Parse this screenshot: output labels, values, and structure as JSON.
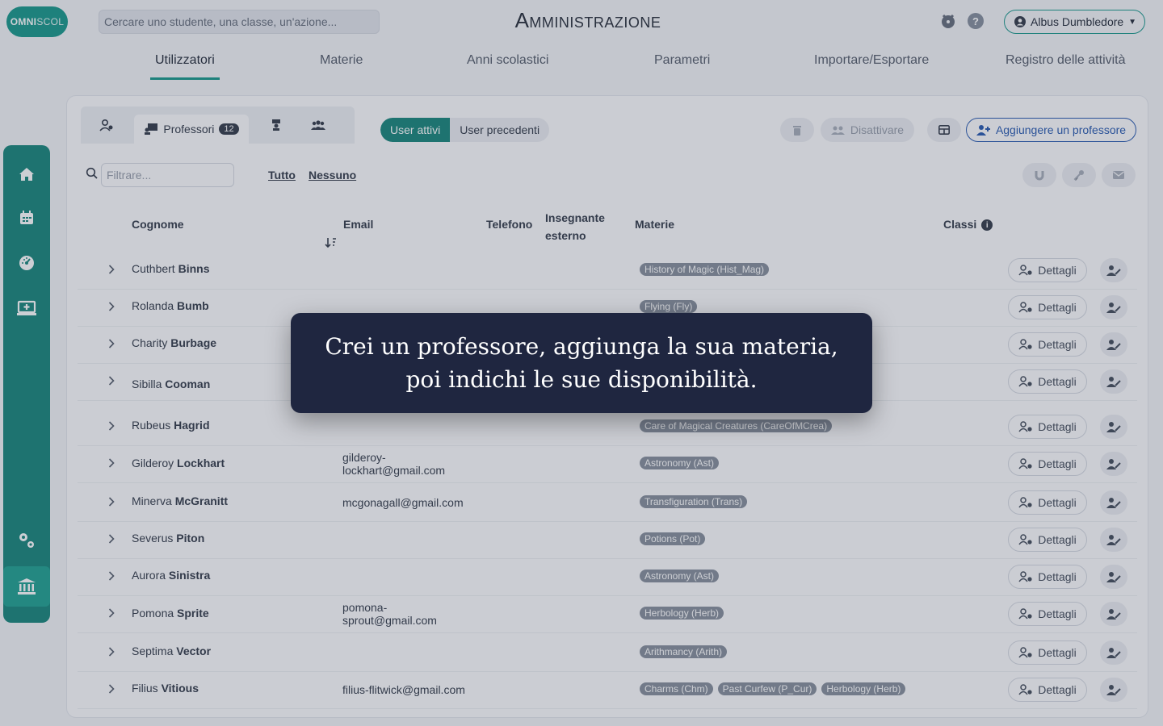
{
  "header": {
    "logo_bold": "OMNI",
    "logo_light": "SCOL",
    "search_placeholder": "Cercare uno studente, una classe, un'azione...",
    "title": "Amministrazione",
    "user_name": "Albus Dumbledore"
  },
  "tabs": [
    {
      "label": "Utilizzatori",
      "active": true
    },
    {
      "label": "Materie"
    },
    {
      "label": "Anni scolastici"
    },
    {
      "label": "Parametri"
    },
    {
      "label": "Importare/Esportare"
    },
    {
      "label": "Registro delle attività"
    }
  ],
  "sidebar": {
    "items": [
      "home-icon",
      "calendar-icon",
      "dashboard-icon",
      "desktop-add-icon",
      "settings-icon",
      "institution-icon"
    ]
  },
  "subtabs": {
    "professors_label": "Professori",
    "professors_count": "12"
  },
  "segment": {
    "active_users": "User attivi",
    "previous_users": "User precedenti"
  },
  "toolbar": {
    "deactivate": "Disattivare",
    "add_professor": "Aggiungere un professore"
  },
  "filter": {
    "placeholder": "Filtrare...",
    "all": "Tutto",
    "none": "Nessuno"
  },
  "table": {
    "headers": {
      "surname": "Cognome",
      "email": "Email",
      "phone": "Telefono",
      "external_line1": "Insegnante",
      "external_line2": "esterno",
      "subjects": "Materie",
      "classes": "Classi"
    },
    "detail_label": "Dettagli",
    "rows": [
      {
        "first": "Cuthbert",
        "last": "Binns",
        "email1": "",
        "email2": "",
        "subjects": [
          "History of Magic (Hist_Mag)"
        ]
      },
      {
        "first": "Rolanda",
        "last": "Bumb",
        "email1": "",
        "email2": "",
        "subjects": [
          "Flying (Fly)"
        ]
      },
      {
        "first": "Charity",
        "last": "Burbage",
        "email1": "",
        "email2": "",
        "subjects": []
      },
      {
        "first": "Sibilla",
        "last": "Cooman",
        "email1": "",
        "email2": "",
        "subjects": []
      },
      {
        "first": "Rubeus",
        "last": "Hagrid",
        "email1": "",
        "email2": "",
        "subjects": [
          "Care of Magical Creatures (CareOfMCrea)"
        ]
      },
      {
        "first": "Gilderoy",
        "last": "Lockhart",
        "email1": "gilderoy-",
        "email2": "lockhart@gmail.com",
        "subjects": [
          "Astronomy (Ast)"
        ]
      },
      {
        "first": "Minerva",
        "last": "McGranitt",
        "email1": "mcgonagall@gmail.com",
        "email2": "",
        "subjects": [
          "Transfiguration (Trans)"
        ]
      },
      {
        "first": "Severus",
        "last": "Piton",
        "email1": "",
        "email2": "",
        "subjects": [
          "Potions (Pot)"
        ]
      },
      {
        "first": "Aurora",
        "last": "Sinistra",
        "email1": "",
        "email2": "",
        "subjects": [
          "Astronomy (Ast)"
        ]
      },
      {
        "first": "Pomona",
        "last": "Sprite",
        "email1": "pomona-",
        "email2": "sprout@gmail.com",
        "subjects": [
          "Herbology (Herb)"
        ]
      },
      {
        "first": "Septima",
        "last": "Vector",
        "email1": "",
        "email2": "",
        "subjects": [
          "Arithmancy (Arith)"
        ]
      },
      {
        "first": "Filius",
        "last": "Vitious",
        "email1": "filius-flitwick@gmail.com",
        "email2": "",
        "subjects": [
          "Charms (Chm)",
          "Past Curfew (P_Cur)",
          "Herbology (Herb)"
        ]
      }
    ]
  },
  "tooltip": {
    "text": "Crei un professore, aggiunga la sua materia, poi indichi le sue disponibilità."
  },
  "colors": {
    "accent": "#1f8a7f",
    "primary_blue": "#2f5fb3",
    "tooltip_bg": "#1f2640"
  }
}
